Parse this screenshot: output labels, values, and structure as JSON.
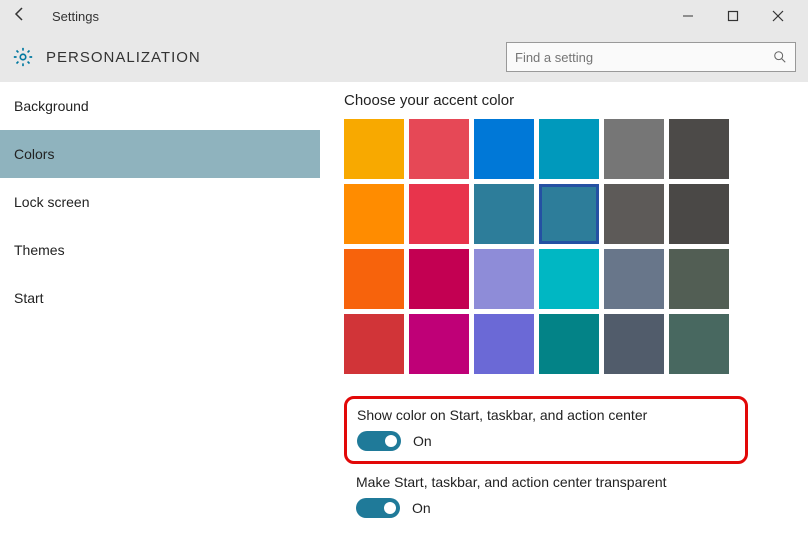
{
  "window": {
    "title": "Settings"
  },
  "header": {
    "category": "PERSONALIZATION",
    "search_placeholder": "Find a setting"
  },
  "sidebar": {
    "items": [
      {
        "label": "Background"
      },
      {
        "label": "Colors"
      },
      {
        "label": "Lock screen"
      },
      {
        "label": "Themes"
      },
      {
        "label": "Start"
      }
    ],
    "active_index": 1
  },
  "content": {
    "accent_title": "Choose your accent color",
    "colors": [
      "#f8a900",
      "#e64856",
      "#0078d7",
      "#0099bc",
      "#767676",
      "#4c4a48",
      "#ff8c00",
      "#e8344c",
      "#2d7d9a",
      "#2d7d9a",
      "#5d5a58",
      "#4a4846",
      "#f7630c",
      "#c30052",
      "#8e8cd8",
      "#00b7c3",
      "#68768a",
      "#525e54",
      "#d13438",
      "#bf0077",
      "#6b69d6",
      "#038387",
      "#515c6b",
      "#486860"
    ],
    "selected_color_index": 9,
    "option1": {
      "label": "Show color on Start, taskbar, and action center",
      "state": "On"
    },
    "option2": {
      "label": "Make Start, taskbar, and action center transparent",
      "state": "On"
    }
  }
}
